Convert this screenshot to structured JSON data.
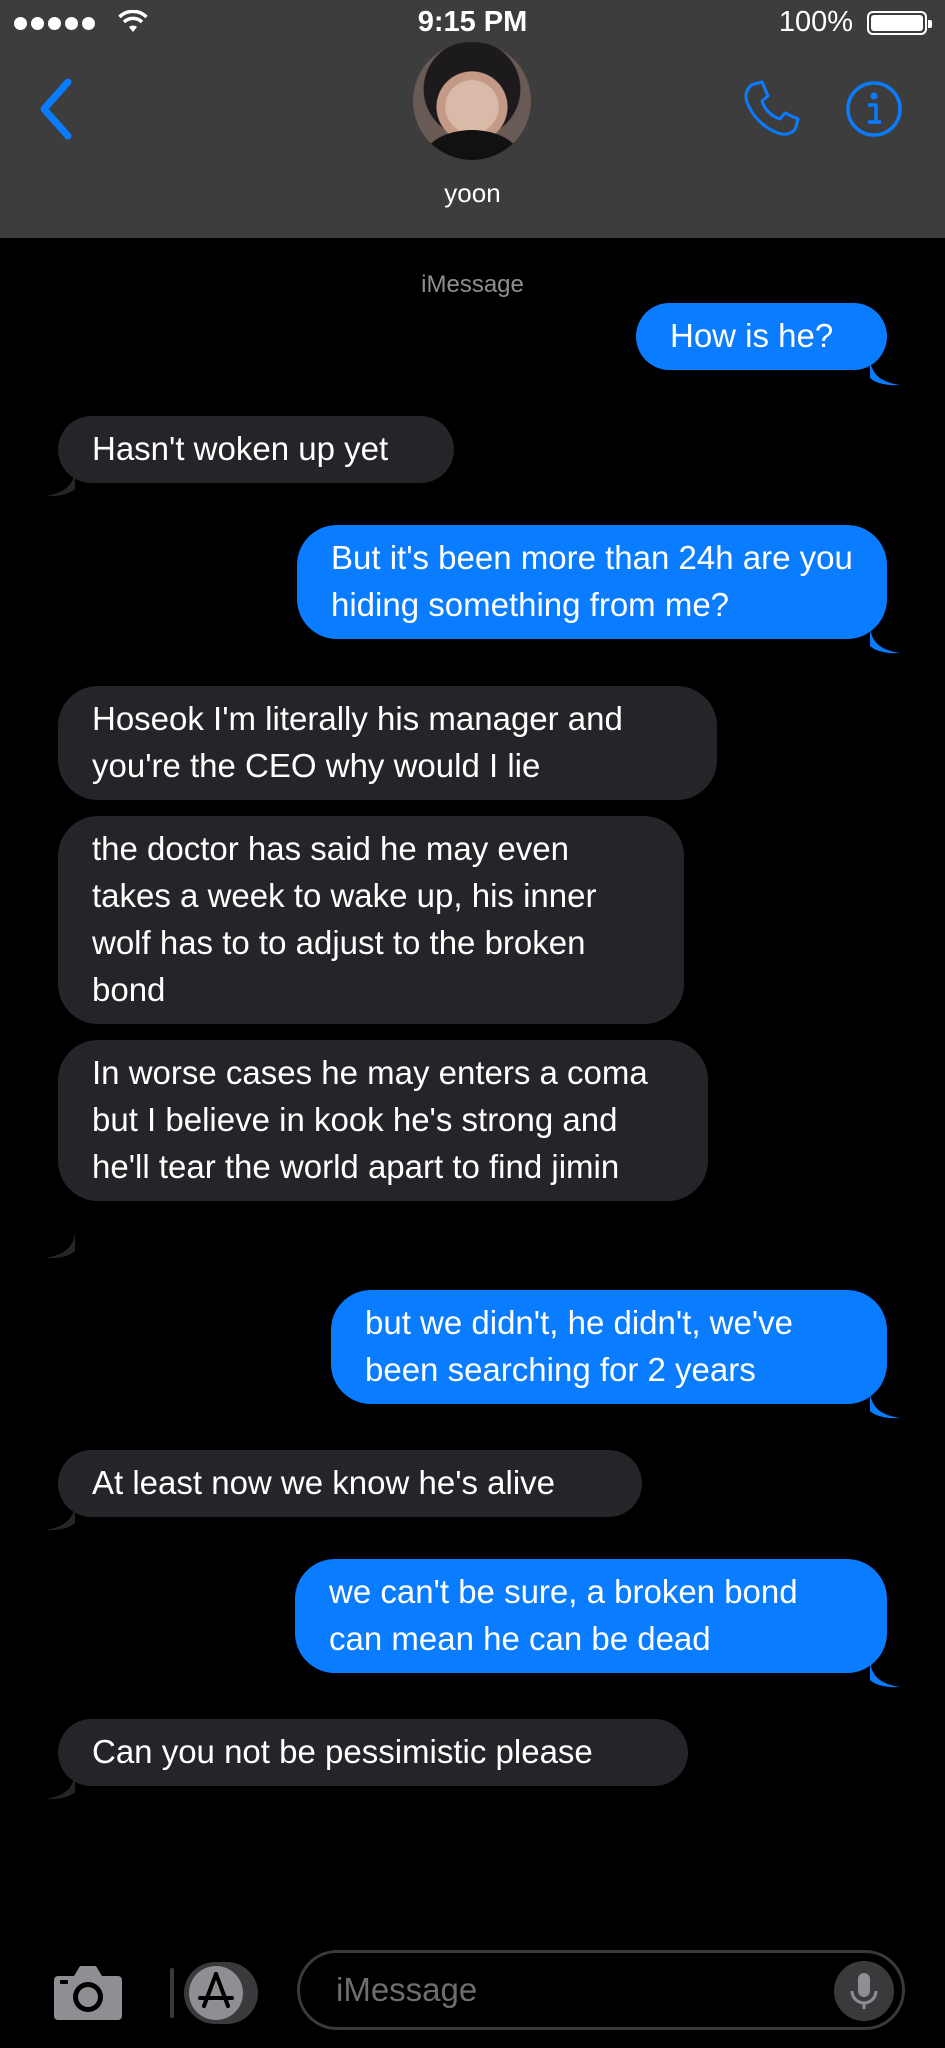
{
  "status_bar": {
    "time": "9:15 PM",
    "battery": "100%"
  },
  "header": {
    "contact_name": "yoon"
  },
  "conversation": {
    "service_label": "iMessage",
    "messages": [
      {
        "from": "me",
        "text": "How is he?"
      },
      {
        "from": "them",
        "text": "Hasn't woken up yet"
      },
      {
        "from": "me",
        "text": "But it's been more than 24h are you hiding something from me?"
      },
      {
        "from": "them",
        "text": "Hoseok I'm literally his manager and you're the CEO why would I lie"
      },
      {
        "from": "them",
        "text": "the doctor has said he may even takes a week to wake up, his inner wolf has to to adjust to the broken bond"
      },
      {
        "from": "them",
        "text": "In worse cases he may enters a coma but I believe in kook he's strong and he'll tear the world apart to find jimin"
      },
      {
        "from": "me",
        "text": "but we didn't, he didn't, we've been searching for 2 years"
      },
      {
        "from": "them",
        "text": "At least now we know he's alive"
      },
      {
        "from": "me",
        "text": "we can't be sure, a broken bond can mean he can be dead"
      },
      {
        "from": "them",
        "text": "Can you not be pessimistic please"
      }
    ]
  },
  "input_bar": {
    "placeholder": "iMessage"
  },
  "colors": {
    "outgoing": "#0a7cff",
    "incoming": "#252428",
    "accent": "#0a7cff",
    "header": "#3d3d3d"
  }
}
